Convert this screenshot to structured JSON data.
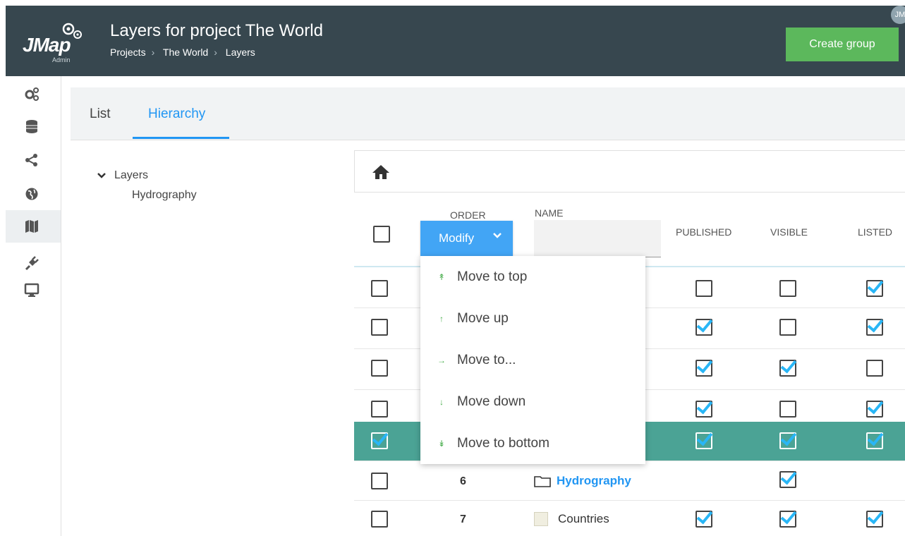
{
  "header": {
    "logo_text": "JMap",
    "logo_sub": "Admin",
    "title": "Layers for project The World",
    "breadcrumbs": [
      "Projects",
      "The World",
      "Layers"
    ],
    "avatar_initials": "JM",
    "create_button": "Create group"
  },
  "nav": {
    "items": [
      "gears-icon",
      "database-icon",
      "share-icon",
      "globe-icon",
      "map-icon",
      "plug-icon",
      "monitor-icon"
    ],
    "active": "map-icon"
  },
  "tabs": [
    {
      "label": "List",
      "active": false
    },
    {
      "label": "Hierarchy",
      "active": true
    }
  ],
  "tree": {
    "root": "Layers",
    "children": [
      "Hydrography"
    ]
  },
  "table": {
    "headers": {
      "order": "ORDER",
      "name": "NAME",
      "published": "PUBLISHED",
      "visible": "VISIBLE",
      "listed": "LISTED"
    },
    "modify_label": "Modify",
    "rows": [
      {
        "order": "",
        "name": "",
        "selected": false,
        "published": false,
        "visible": false,
        "listed": true
      },
      {
        "order": "",
        "name": "",
        "selected": false,
        "published": true,
        "visible": false,
        "listed": true
      },
      {
        "order": "",
        "name": "",
        "selected": false,
        "published": true,
        "visible": true,
        "listed": false
      },
      {
        "order": "",
        "name": "",
        "selected": false,
        "published": true,
        "visible": false,
        "listed": true
      },
      {
        "order": "",
        "name": "",
        "selected": true,
        "published": true,
        "visible": true,
        "listed": true
      },
      {
        "order": "6",
        "name": "Hydrography",
        "folder": true,
        "selected": false,
        "published": null,
        "visible": true,
        "listed": null
      },
      {
        "order": "7",
        "name": "Countries",
        "folder": false,
        "selected": false,
        "published": true,
        "visible": true,
        "listed": true
      }
    ]
  },
  "menu": {
    "items": [
      {
        "icon": "↟",
        "label": "Move to top"
      },
      {
        "icon": "↑",
        "label": "Move up"
      },
      {
        "icon": "→",
        "label": "Move to..."
      },
      {
        "icon": "↓",
        "label": "Move down"
      },
      {
        "icon": "↡",
        "label": "Move to bottom"
      }
    ]
  },
  "colors": {
    "topbar": "#37474f",
    "create_button": "#5cb85c",
    "accent_blue": "#2196f3",
    "selected_row": "#4ba395",
    "check": "#29b6f6"
  }
}
